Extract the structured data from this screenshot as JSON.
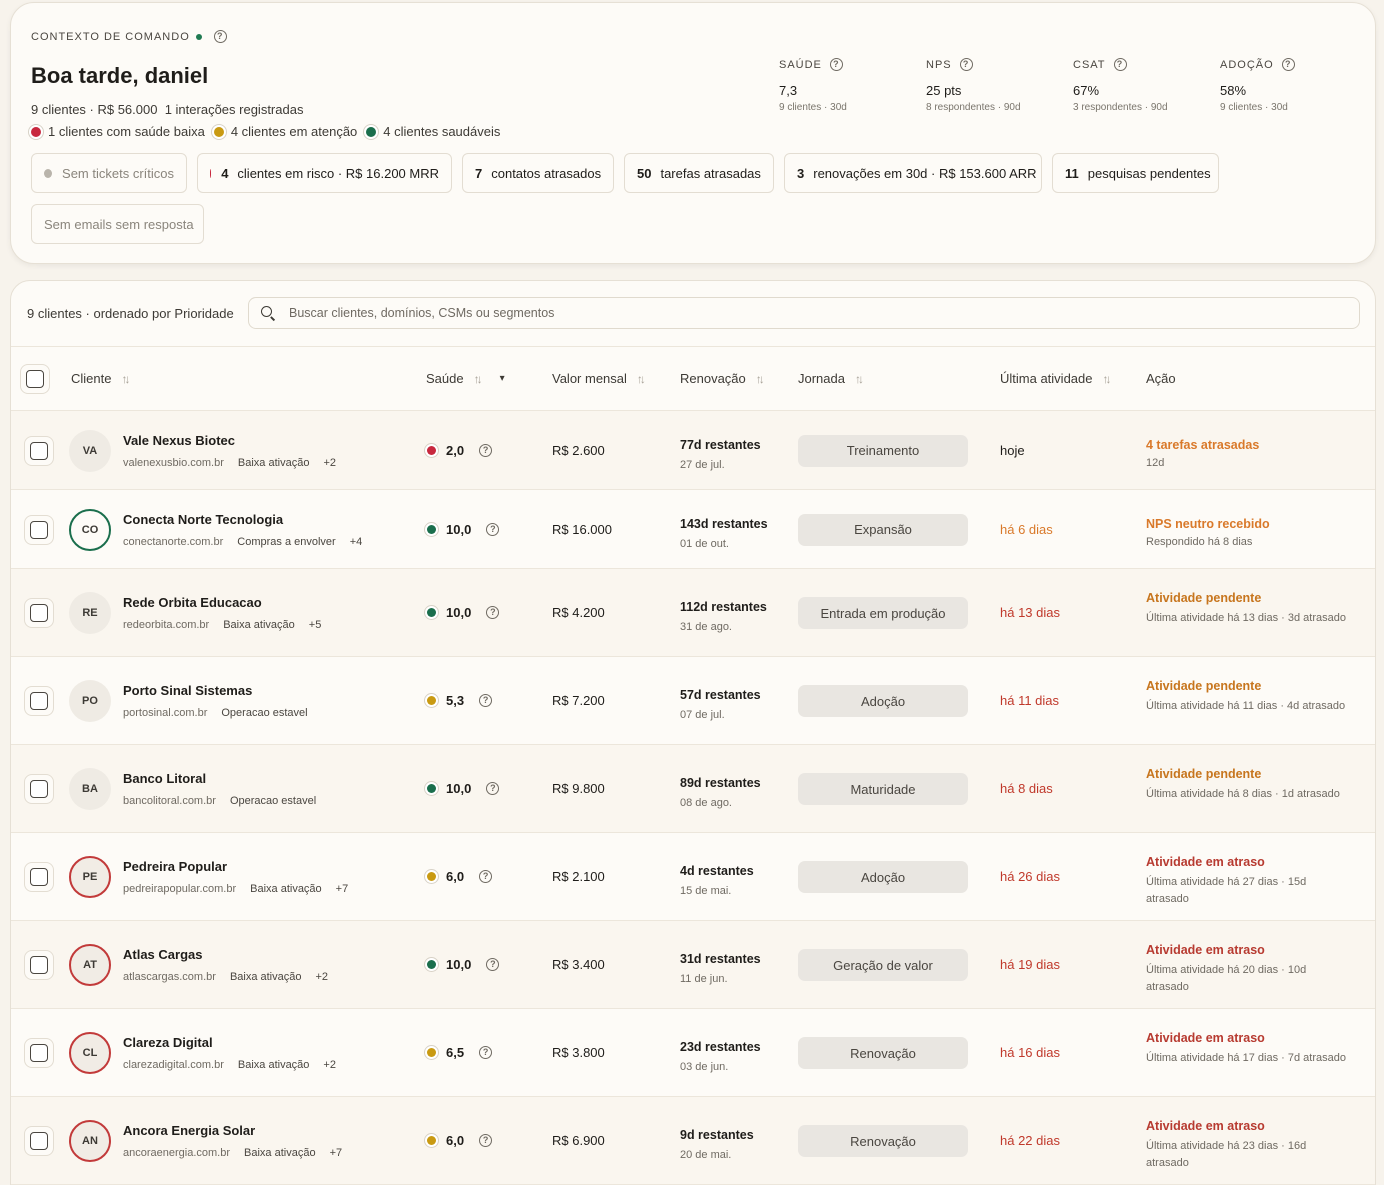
{
  "header": {
    "context_label": "CONTEXTO DE COMANDO",
    "greeting": "Boa tarde, daniel",
    "summary": "9 clientes · R$ 56.000",
    "interactions": "1 interações registradas",
    "legend": [
      {
        "label": "1 clientes com saúde baixa",
        "color": "red"
      },
      {
        "label": "4 clientes em atenção",
        "color": "yellow"
      },
      {
        "label": "4 clientes saudáveis",
        "color": "green"
      }
    ]
  },
  "metrics": [
    {
      "name": "SAÚDE",
      "value": "7,3",
      "sub": "9 clientes · 30d"
    },
    {
      "name": "NPS",
      "value": "25 pts",
      "sub": "8 respondentes · 90d"
    },
    {
      "name": "CSAT",
      "value": "67%",
      "sub": "3 respondentes · 90d"
    },
    {
      "name": "ADOÇÃO",
      "value": "58%",
      "sub": "9 clientes · 30d"
    }
  ],
  "chips": {
    "tickets": "Sem tickets críticos",
    "risk_num": "4",
    "risk_label": "clientes em risco · R$ 16.200 MRR",
    "contacts_num": "7",
    "contacts_label": "contatos atrasados",
    "tasks_num": "50",
    "tasks_label": "tarefas atrasadas",
    "renewals_num": "3",
    "renewals_label": "renovações em 30d · R$ 153.600 ARR",
    "surveys_num": "11",
    "surveys_label": "pesquisas pendentes",
    "emails": "Sem emails sem resposta"
  },
  "list": {
    "count_label": "9 clientes · ordenado por Prioridade",
    "search_placeholder": "Buscar clientes, domínios, CSMs ou segmentos",
    "columns": {
      "client": "Cliente",
      "health": "Saúde",
      "mrr": "Valor mensal",
      "renewal": "Renovação",
      "journey": "Jornada",
      "last_activity": "Última atividade",
      "action": "Ação"
    }
  },
  "colors": {
    "red": "#c8283e",
    "yellow": "#c99a12",
    "green": "#1a6e4c",
    "accent_orange": "#d9792a"
  },
  "rows": [
    {
      "initials": "VA",
      "ring": "none",
      "name": "Vale Nexus Biotec",
      "domain": "valenexusbio.com.br",
      "segment": "Baixa ativação",
      "extra": "+2",
      "health": "2,0",
      "health_color": "red",
      "mrr": "R$ 2.600",
      "ren_days": "77d restantes",
      "ren_date": "27 de jul.",
      "journey": "Treinamento",
      "last": "hoje",
      "last_tone": "normal",
      "act_title": "4 tarefas atrasadas",
      "act_tone": "orange",
      "act_sub": "12d"
    },
    {
      "initials": "CO",
      "ring": "green",
      "name": "Conecta Norte Tecnologia",
      "domain": "conectanorte.com.br",
      "segment": "Compras a envolver",
      "extra": "+4",
      "health": "10,0",
      "health_color": "green",
      "mrr": "R$ 16.000",
      "ren_days": "143d restantes",
      "ren_date": "01 de out.",
      "journey": "Expansão",
      "last": "há 6 dias",
      "last_tone": "warn",
      "act_title": "NPS neutro recebido",
      "act_tone": "orange",
      "act_sub": "Respondido há 8 dias"
    },
    {
      "initials": "RE",
      "ring": "none",
      "name": "Rede Orbita Educacao",
      "domain": "redeorbita.com.br",
      "segment": "Baixa ativação",
      "extra": "+5",
      "health": "10,0",
      "health_color": "green",
      "mrr": "R$ 4.200",
      "ren_days": "112d restantes",
      "ren_date": "31 de ago.",
      "journey": "Entrada em produção",
      "last": "há 13 dias",
      "last_tone": "danger",
      "act_title": "Atividade pendente",
      "act_tone": "amber",
      "act_sub": "Última atividade há 13 dias · 3d atrasado"
    },
    {
      "initials": "PO",
      "ring": "none",
      "name": "Porto Sinal Sistemas",
      "domain": "portosinal.com.br",
      "segment": "Operacao estavel",
      "extra": "",
      "health": "5,3",
      "health_color": "yellow",
      "mrr": "R$ 7.200",
      "ren_days": "57d restantes",
      "ren_date": "07 de jul.",
      "journey": "Adoção",
      "last": "há 11 dias",
      "last_tone": "danger",
      "act_title": "Atividade pendente",
      "act_tone": "amber",
      "act_sub": "Última atividade há 11 dias · 4d atrasado"
    },
    {
      "initials": "BA",
      "ring": "none",
      "name": "Banco Litoral",
      "domain": "bancolitoral.com.br",
      "segment": "Operacao estavel",
      "extra": "",
      "health": "10,0",
      "health_color": "green",
      "mrr": "R$ 9.800",
      "ren_days": "89d restantes",
      "ren_date": "08 de ago.",
      "journey": "Maturidade",
      "last": "há 8 dias",
      "last_tone": "danger",
      "act_title": "Atividade pendente",
      "act_tone": "amber",
      "act_sub": "Última atividade há 8 dias · 1d atrasado"
    },
    {
      "initials": "PE",
      "ring": "red",
      "name": "Pedreira Popular",
      "domain": "pedreirapopular.com.br",
      "segment": "Baixa ativação",
      "extra": "+7",
      "health": "6,0",
      "health_color": "yellow",
      "mrr": "R$ 2.100",
      "ren_days": "4d restantes",
      "ren_date": "15 de mai.",
      "journey": "Adoção",
      "last": "há 26 dias",
      "last_tone": "danger",
      "act_title": "Atividade em atraso",
      "act_tone": "red",
      "act_sub": "Última atividade há 27 dias · 15d atrasado"
    },
    {
      "initials": "AT",
      "ring": "red",
      "name": "Atlas Cargas",
      "domain": "atlascargas.com.br",
      "segment": "Baixa ativação",
      "extra": "+2",
      "health": "10,0",
      "health_color": "green",
      "mrr": "R$ 3.400",
      "ren_days": "31d restantes",
      "ren_date": "11 de jun.",
      "journey": "Geração de valor",
      "last": "há 19 dias",
      "last_tone": "danger",
      "act_title": "Atividade em atraso",
      "act_tone": "red",
      "act_sub": "Última atividade há 20 dias · 10d atrasado"
    },
    {
      "initials": "CL",
      "ring": "red",
      "name": "Clareza Digital",
      "domain": "clarezadigital.com.br",
      "segment": "Baixa ativação",
      "extra": "+2",
      "health": "6,5",
      "health_color": "yellow",
      "mrr": "R$ 3.800",
      "ren_days": "23d restantes",
      "ren_date": "03 de jun.",
      "journey": "Renovação",
      "last": "há 16 dias",
      "last_tone": "danger",
      "act_title": "Atividade em atraso",
      "act_tone": "red",
      "act_sub": "Última atividade há 17 dias · 7d atrasado"
    },
    {
      "initials": "AN",
      "ring": "red",
      "name": "Ancora Energia Solar",
      "domain": "ancoraenergia.com.br",
      "segment": "Baixa ativação",
      "extra": "+7",
      "health": "6,0",
      "health_color": "yellow",
      "mrr": "R$ 6.900",
      "ren_days": "9d restantes",
      "ren_date": "20 de mai.",
      "journey": "Renovação",
      "last": "há 22 dias",
      "last_tone": "danger",
      "act_title": "Atividade em atraso",
      "act_tone": "red",
      "act_sub": "Última atividade há 23 dias · 16d atrasado"
    }
  ]
}
